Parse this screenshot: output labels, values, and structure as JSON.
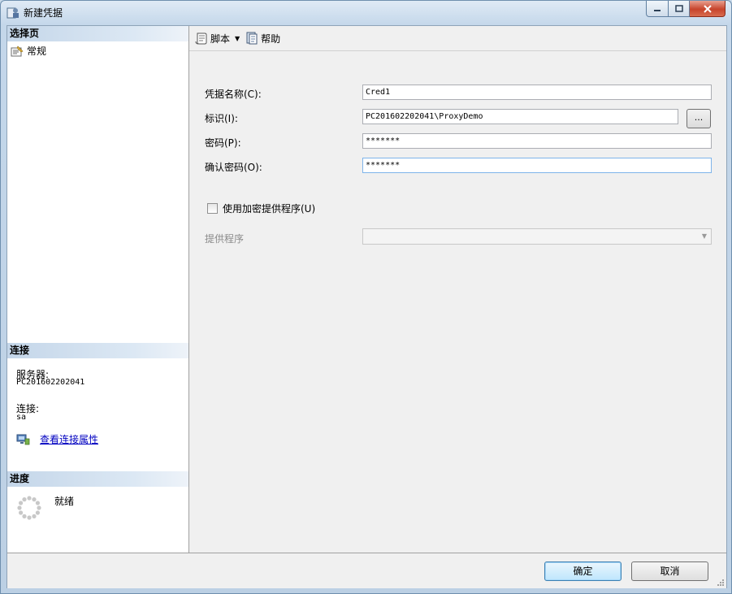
{
  "window": {
    "title": "新建凭据"
  },
  "left": {
    "select_page_header": "选择页",
    "pages": [
      {
        "label": "常规"
      }
    ],
    "connection_header": "连接",
    "server_label": "服务器:",
    "server_value": "PC201602202041",
    "connection_label": "连接:",
    "connection_value": "sa",
    "view_properties_link": "查看连接属性",
    "progress_header": "进度",
    "progress_status": "就绪"
  },
  "toolbar": {
    "script_label": "脚本",
    "help_label": "帮助"
  },
  "form": {
    "credential_name_label": "凭据名称(C):",
    "credential_name_value": "Cred1",
    "identity_label": "标识(I):",
    "identity_value": "PC201602202041\\ProxyDemo",
    "browse_label": "...",
    "password_label": "密码(P):",
    "password_value": "*******",
    "confirm_password_label": "确认密码(O):",
    "confirm_password_value": "*******",
    "use_provider_label": "使用加密提供程序(U)",
    "provider_label": "提供程序",
    "provider_value": ""
  },
  "buttons": {
    "ok_label": "确定",
    "cancel_label": "取消"
  }
}
